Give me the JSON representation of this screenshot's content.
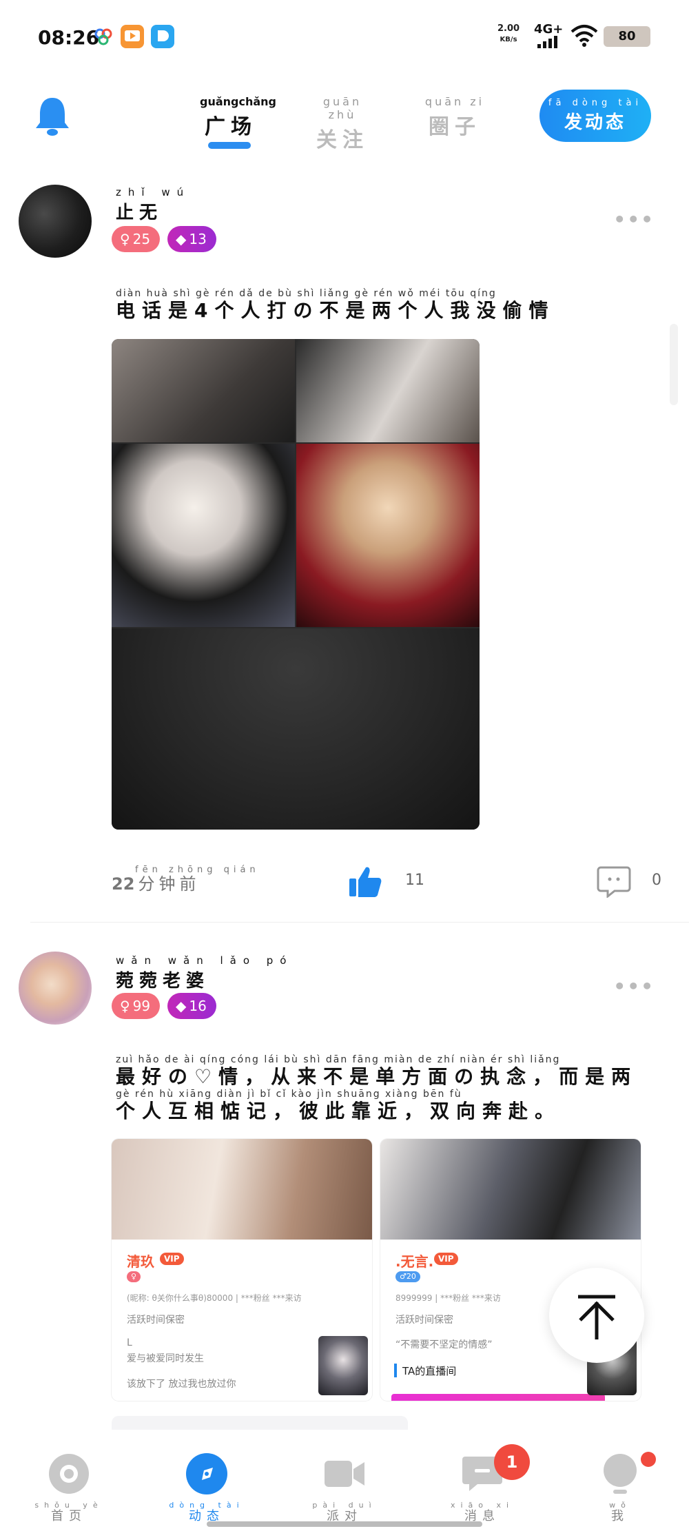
{
  "status_bar": {
    "time": "08:26",
    "speed_value": "2.00",
    "speed_unit": "KB/s",
    "network": "4G+",
    "battery": "80"
  },
  "top_nav": {
    "tabs": [
      {
        "pinyin": "guǎngchǎng",
        "label": "广场",
        "active": true
      },
      {
        "pinyin": "guān zhù",
        "label": "关注",
        "active": false
      },
      {
        "pinyin": "quān zi",
        "label": "圈子",
        "active": false
      }
    ],
    "post_button": {
      "pinyin": "fā dòng tài",
      "label": "发动态"
    },
    "colors": {
      "accent": "#2b8df0"
    }
  },
  "posts": [
    {
      "username_pinyin": "zhǐ  wú",
      "username": "止无",
      "gender": "♀",
      "age": "25",
      "level": "13",
      "text_pinyin": "diàn huà shì  gè rén dǎ de bù shì liǎng gè rén wǒ méi tōu qíng",
      "text": "电话是4个人打の不是两个人我没偷情",
      "time_num": "22",
      "time_pinyin": "fēn zhōng qián",
      "time_text": "分钟前",
      "likes": "11",
      "comments": "0"
    },
    {
      "username_pinyin": "wǎn wǎn lǎo pó",
      "username": "菀菀老婆",
      "gender": "♀",
      "age": "99",
      "level": "16",
      "text_pinyin_1": "zuì hǎo de ài qíng  cóng lái bù shì dān fāng miàn de zhí niàn  ér shì liǎng",
      "text_1": "最好の♡情，从来不是单方面の执念，而是两",
      "text_pinyin_2": "gè rén hù xiāng diàn jì  bǐ cǐ kào jìn  shuāng xiàng bēn fù",
      "text_2": "个人互相惦记，彼此靠近，双向奔赴。",
      "cards": [
        {
          "name": "清玖",
          "vip": "VIP",
          "gender_badge": "♀",
          "id_line": "(昵称: θ关你什么事θ)80000 | ***粉丝 ***来访",
          "active": "活跃时间保密",
          "line3": "L",
          "line4": "爱与被爱同时发生",
          "line5": "该放下了 放过我也放过你"
        },
        {
          "name": ".无言.",
          "vip": "VIP",
          "gender_badge": "♂20",
          "id_line": "8999999 | ***粉丝 ***来访",
          "active": "活跃时间保密",
          "line3": "“不需要不坚定的情感”",
          "live_title": "TA的直播间"
        }
      ]
    }
  ],
  "bottom_nav": [
    {
      "pinyin": "shǒu yè",
      "label": "首页",
      "active": false
    },
    {
      "pinyin": "dòng tài",
      "label": "动态",
      "active": true
    },
    {
      "pinyin": "pài duì",
      "label": "派对",
      "active": false
    },
    {
      "pinyin": "xiāo xi",
      "label": "消息",
      "active": false
    },
    {
      "pinyin": "wǒ",
      "label": "我",
      "active": false
    }
  ],
  "message_badge": "1"
}
